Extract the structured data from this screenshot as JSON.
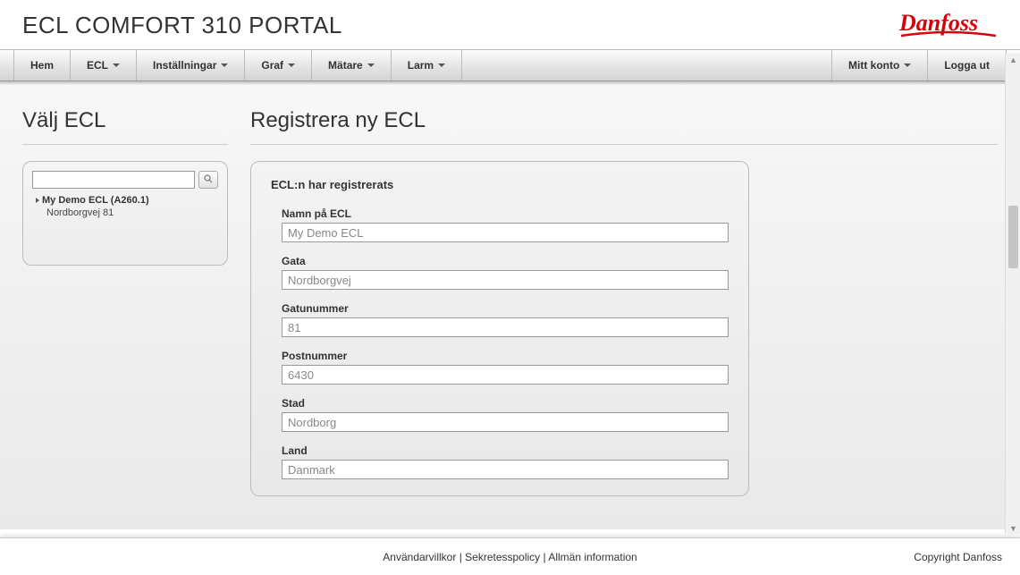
{
  "header": {
    "title": "ECL COMFORT 310 PORTAL",
    "logo_text": "Danfoss"
  },
  "nav": {
    "left": [
      "Hem",
      "ECL",
      "Inställningar",
      "Graf",
      "Mätare",
      "Larm"
    ],
    "left_has_caret": [
      false,
      true,
      true,
      true,
      true,
      true
    ],
    "right": [
      "Mitt konto",
      "Logga ut"
    ],
    "right_has_caret": [
      true,
      false
    ]
  },
  "sidebar": {
    "title": "Välj ECL",
    "search_value": "",
    "ecl": {
      "name": "My Demo ECL (A260.1)",
      "address": "Nordborgvej 81"
    }
  },
  "main": {
    "title": "Registrera ny ECL",
    "form_heading": "ECL:n har registrerats",
    "fields": {
      "name": {
        "label": "Namn på ECL",
        "value": "My Demo ECL"
      },
      "street": {
        "label": "Gata",
        "value": "Nordborgvej"
      },
      "number": {
        "label": "Gatunummer",
        "value": "81"
      },
      "zip": {
        "label": "Postnummer",
        "value": "6430"
      },
      "city": {
        "label": "Stad",
        "value": "Nordborg"
      },
      "country": {
        "label": "Land",
        "value": "Danmark"
      }
    }
  },
  "footer": {
    "links": [
      "Användarvillkor",
      "Sekretesspolicy",
      "Allmän information"
    ],
    "separator": " | ",
    "copyright": "Copyright Danfoss"
  }
}
